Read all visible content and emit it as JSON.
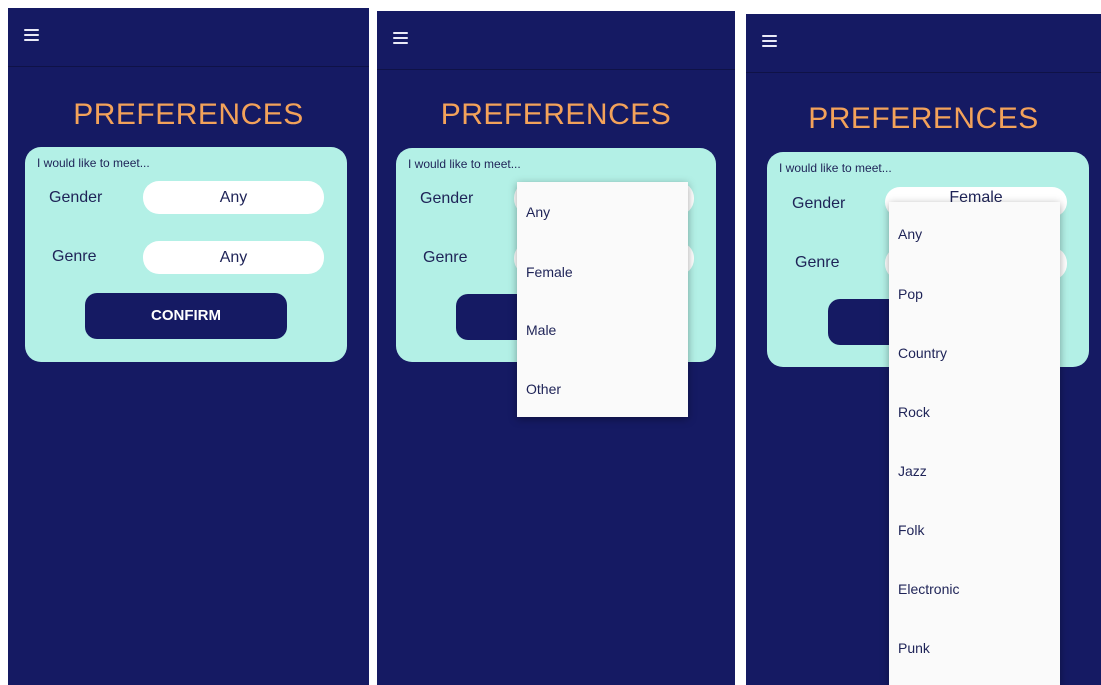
{
  "title": "PREFERENCES",
  "intro": "I would like to meet...",
  "labels": {
    "gender": "Gender",
    "genre": "Genre"
  },
  "screen1": {
    "gender_value": "Any",
    "genre_value": "Any",
    "confirm": "CONFIRM"
  },
  "screen3": {
    "gender_value_partial": "Female"
  },
  "gender_options": [
    "Any",
    "Female",
    "Male",
    "Other"
  ],
  "genre_options": [
    "Any",
    "Pop",
    "Country",
    "Rock",
    "Jazz",
    "Folk",
    "Electronic",
    "Punk"
  ],
  "colors": {
    "background": "#151a63",
    "card": "#b3f0e6",
    "title": "#f3a25a",
    "button": "#151a63"
  }
}
